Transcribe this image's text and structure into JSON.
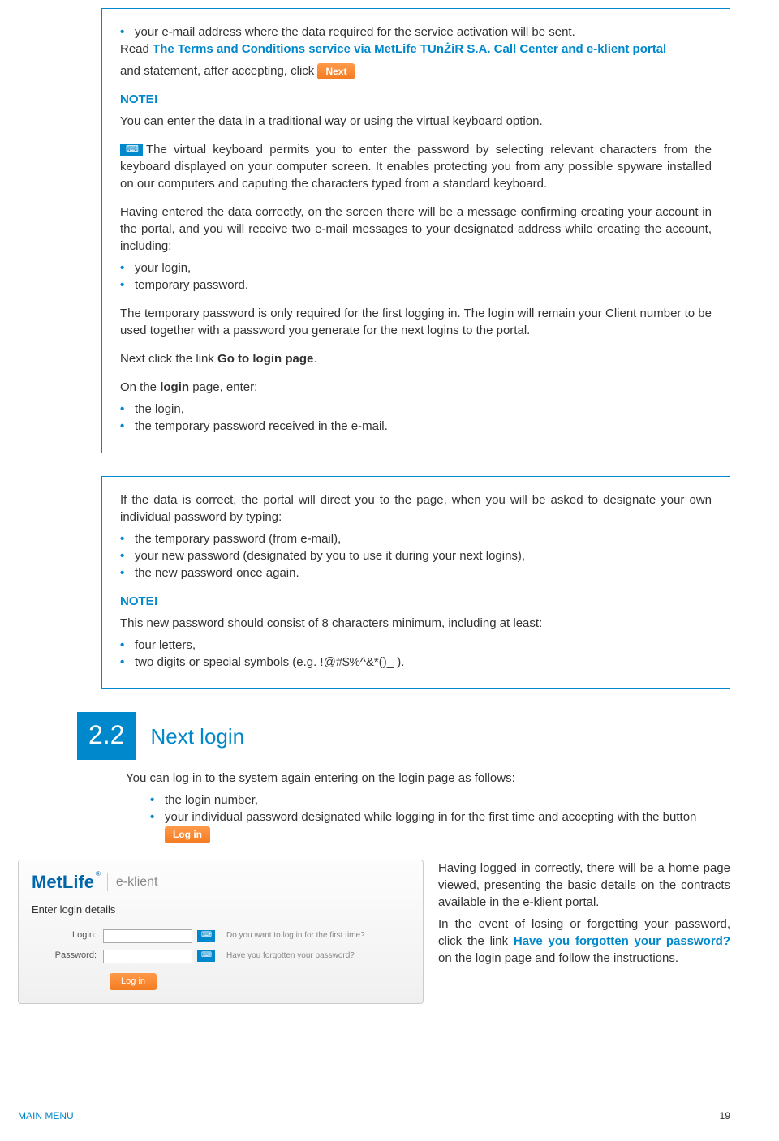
{
  "box1": {
    "b1": "your e-mail address where the data required for the service activation will be sent.",
    "line2_a": "Read ",
    "line2_link": "The Terms and Conditions service via MetLife TUnŻiR S.A. Call Center and e-klient portal",
    "line3": "and statement, after accepting, click",
    "next_label": "Next",
    "note": "NOTE!",
    "note_text": "You can enter the data in a traditional way or using the virtual keyboard option.",
    "vk_text": "The virtual keyboard permits you to enter the password by selecting relevant characters from the keyboard displayed on your computer screen. It enables protecting you from any possible spyware installed on our computers and caputing the characters typed from a standard keyboard.",
    "p_account": "Having entered the data correctly, on the screen there will be a message confirming creating your account in the portal, and you will receive two e-mail messages to your designated address while creating the account, including:",
    "b_login": "your login,",
    "b_temp": "temporary password.",
    "p_temp": "The temporary password is only required for the first logging in. The login will remain your Client number to be used together with a password you generate for the next logins to the portal.",
    "p_click_a": "Next click the link ",
    "p_click_b": "Go to login page",
    "p_click_c": ".",
    "p_login_a": "On the ",
    "p_login_b": "login",
    "p_login_c": " page, enter:",
    "b_thelogin": "the login,",
    "b_tmppwd": "the temporary password received in the e-mail."
  },
  "box2": {
    "intro": "If the data is correct, the portal will direct you to the page, when you will be asked to designate your own individual password by typing:",
    "b1": "the temporary password (from e-mail),",
    "b2": "your new password (designated by you to use it during your next logins),",
    "b3": "the new password once again.",
    "note": "NOTE!",
    "note_text": "This new password should consist of 8 characters minimum, including at least:",
    "bn1": "four letters,",
    "bn2": "two digits or special symbols (e.g. !@#$%^&*()_ )."
  },
  "section": {
    "num": "2.2",
    "title": "Next login",
    "intro": "You can log in to the system again entering on the login page as follows:",
    "b1": "the login number,",
    "b2": "your individual password designated while logging in for the first time and accepting with the button",
    "login_label": "Log in"
  },
  "widget": {
    "brand": "MetLife",
    "sub": "e-klient",
    "enter": "Enter login details",
    "login_label": "Login:",
    "pwd_label": "Password:",
    "q1": "Do you want to log in for the first time?",
    "q2": "Have you forgotten your password?",
    "submit": "Log in"
  },
  "right": {
    "p1": "Having logged in correctly, there will be a home page viewed, presenting the basic details on the contracts available in the e-klient portal.",
    "p2a": "In the event of losing or forgetting your password, click the link ",
    "p2b": "Have you forgotten your password?",
    "p2c": " on the login page and follow the instructions."
  },
  "footer": {
    "left": "MAIN MENU",
    "right": "19"
  }
}
